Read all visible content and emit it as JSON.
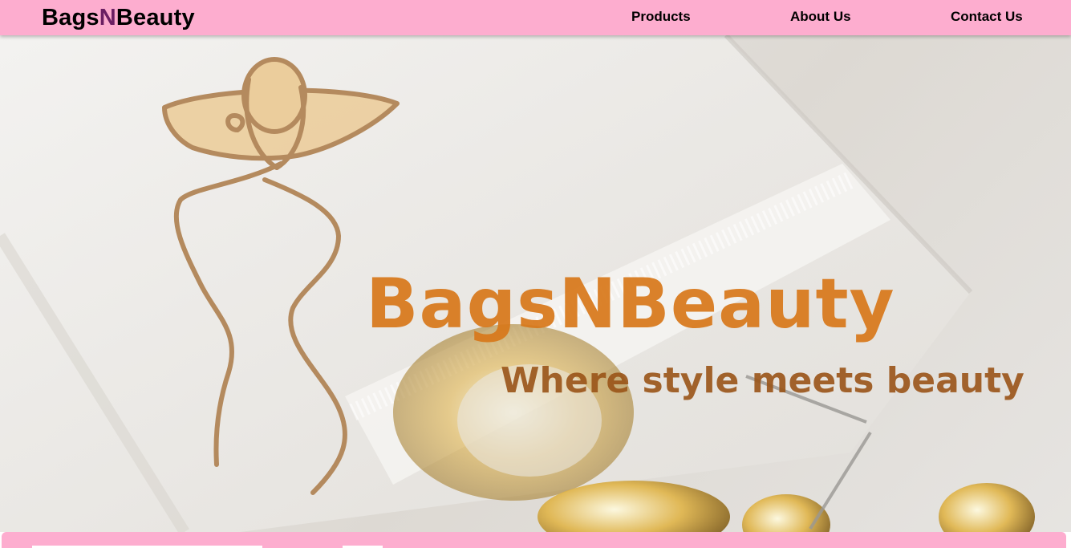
{
  "navbar": {
    "brand_part1": "Bags",
    "brand_part2": "N",
    "brand_part3": "Beauty",
    "links": [
      "Products",
      "About Us",
      "Contact Us"
    ]
  },
  "hero": {
    "title": "BagsNBeauty",
    "tagline": "Where style meets beauty"
  },
  "colors": {
    "navbar_bg": "#fdadcf",
    "brand_accent": "#6b1f63",
    "hero_title": "#d8781a",
    "hero_tagline": "#9a5418"
  }
}
